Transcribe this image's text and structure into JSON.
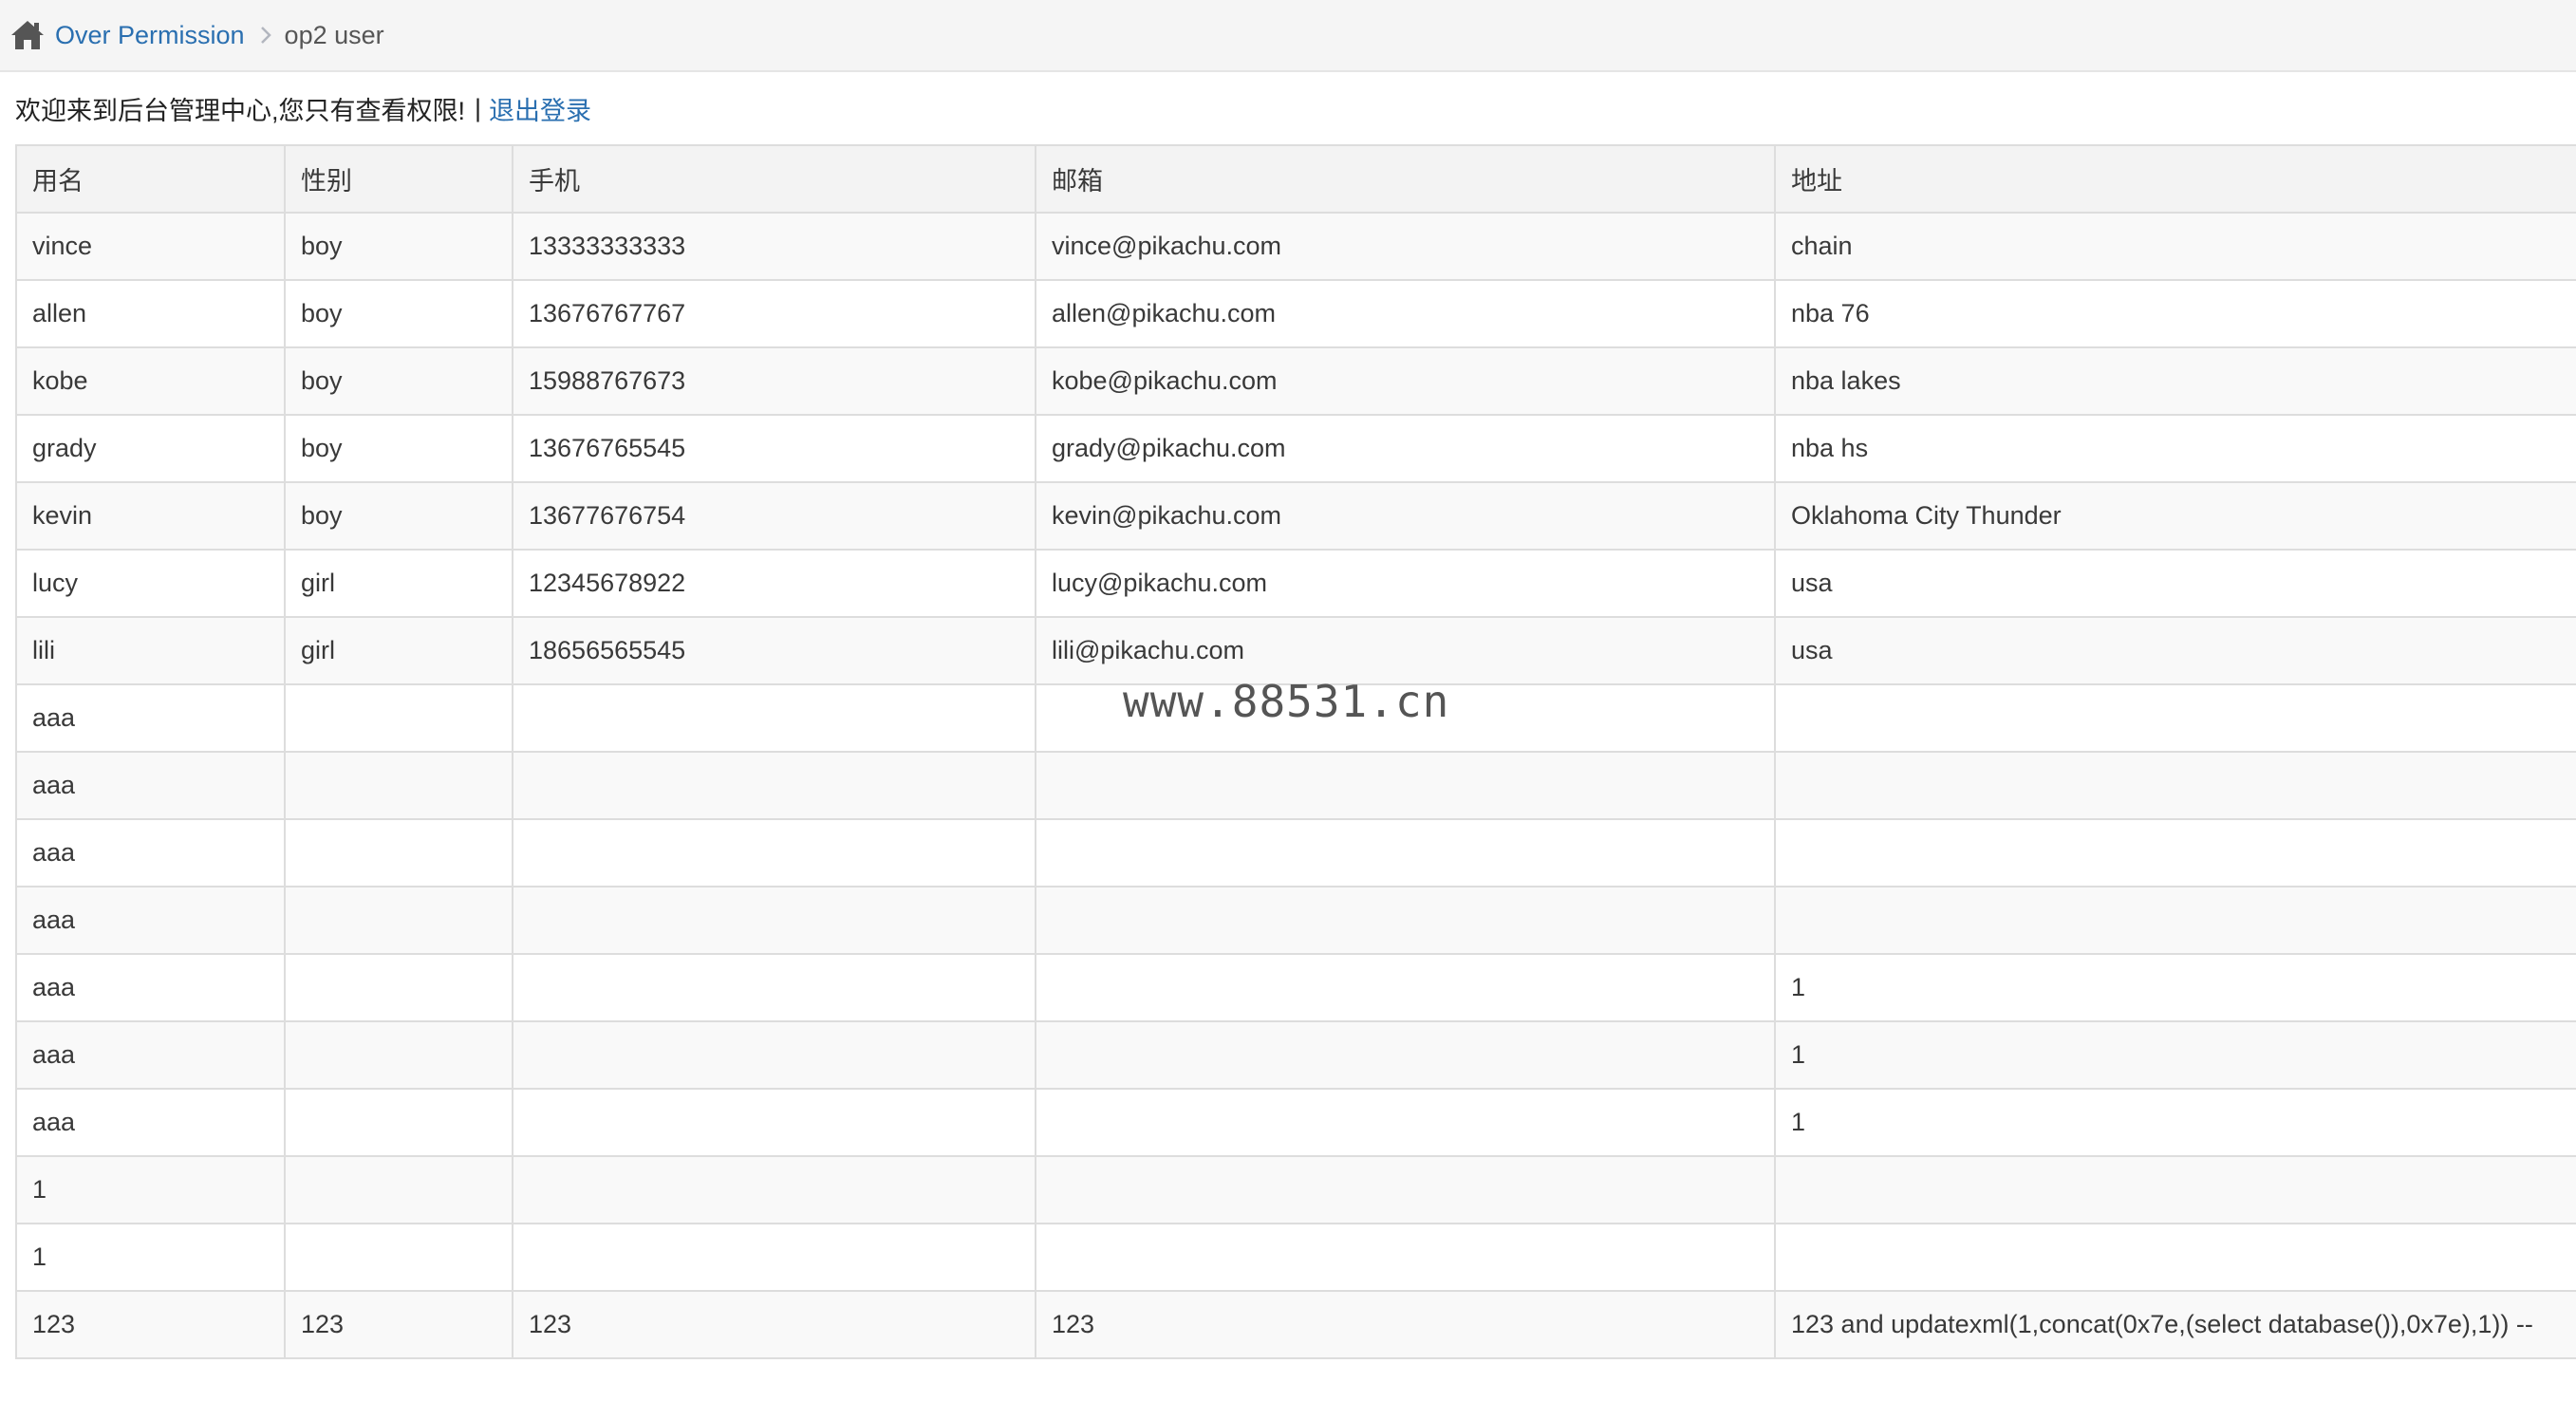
{
  "breadcrumb": {
    "home_icon": "home-icon",
    "link": "Over Permission",
    "current": "op2 user"
  },
  "welcome": {
    "text": "欢迎来到后台管理中心,您只有查看权限!",
    "separator": "|",
    "logout": "退出登录"
  },
  "table": {
    "headers": [
      "用名",
      "性别",
      "手机",
      "邮箱",
      "地址"
    ],
    "rows": [
      [
        "vince",
        "boy",
        "13333333333",
        "vince@pikachu.com",
        "chain"
      ],
      [
        "allen",
        "boy",
        "13676767767",
        "allen@pikachu.com",
        "nba 76"
      ],
      [
        "kobe",
        "boy",
        "15988767673",
        "kobe@pikachu.com",
        "nba lakes"
      ],
      [
        "grady",
        "boy",
        "13676765545",
        "grady@pikachu.com",
        "nba hs"
      ],
      [
        "kevin",
        "boy",
        "13677676754",
        "kevin@pikachu.com",
        "Oklahoma City Thunder"
      ],
      [
        "lucy",
        "girl",
        "12345678922",
        "lucy@pikachu.com",
        "usa"
      ],
      [
        "lili",
        "girl",
        "18656565545",
        "lili@pikachu.com",
        "usa"
      ],
      [
        "aaa",
        "",
        "",
        "",
        ""
      ],
      [
        "aaa",
        "",
        "",
        "",
        ""
      ],
      [
        "aaa",
        "",
        "",
        "",
        ""
      ],
      [
        "aaa",
        "",
        "",
        "",
        ""
      ],
      [
        "aaa",
        "",
        "",
        "",
        "1"
      ],
      [
        "aaa",
        "",
        "",
        "",
        "1"
      ],
      [
        "aaa",
        "",
        "",
        "",
        "1"
      ],
      [
        "1",
        "",
        "",
        "",
        ""
      ],
      [
        "1",
        "",
        "",
        "",
        ""
      ],
      [
        "123",
        "123",
        "123",
        "123",
        "123 and updatexml(1,concat(0x7e,(select database()),0x7e),1)) --"
      ]
    ]
  },
  "watermark": "www.88531.cn",
  "colors": {
    "link": "#2a6fb0",
    "topbar_bg": "#f5f5f5",
    "border": "#dddddd"
  }
}
